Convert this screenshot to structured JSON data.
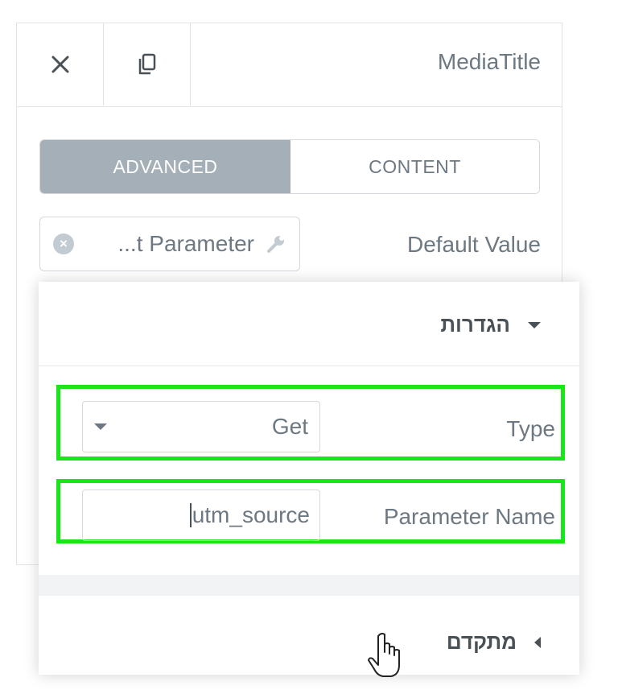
{
  "header": {
    "title": "MediaTitle",
    "close_icon": "close-icon",
    "duplicate_icon": "duplicate-icon"
  },
  "tabs": [
    {
      "label": "ADVANCED",
      "active": true
    },
    {
      "label": "CONTENT",
      "active": false
    }
  ],
  "default_value": {
    "label": "Default Value",
    "chip_text": "...t Parameter",
    "remove_icon": "remove-icon",
    "settings_icon": "wrench-icon"
  },
  "settings_section": {
    "title": "הגדרות",
    "expanded": true,
    "type": {
      "label": "Type",
      "value": "Get"
    },
    "parameter_name": {
      "label": "Parameter Name",
      "value": "utm_source"
    }
  },
  "advanced_section": {
    "title": "מתקדם",
    "expanded": false
  },
  "colors": {
    "highlight": "#19e619",
    "active_tab": "#a4afb7",
    "text": "#6d7882"
  }
}
